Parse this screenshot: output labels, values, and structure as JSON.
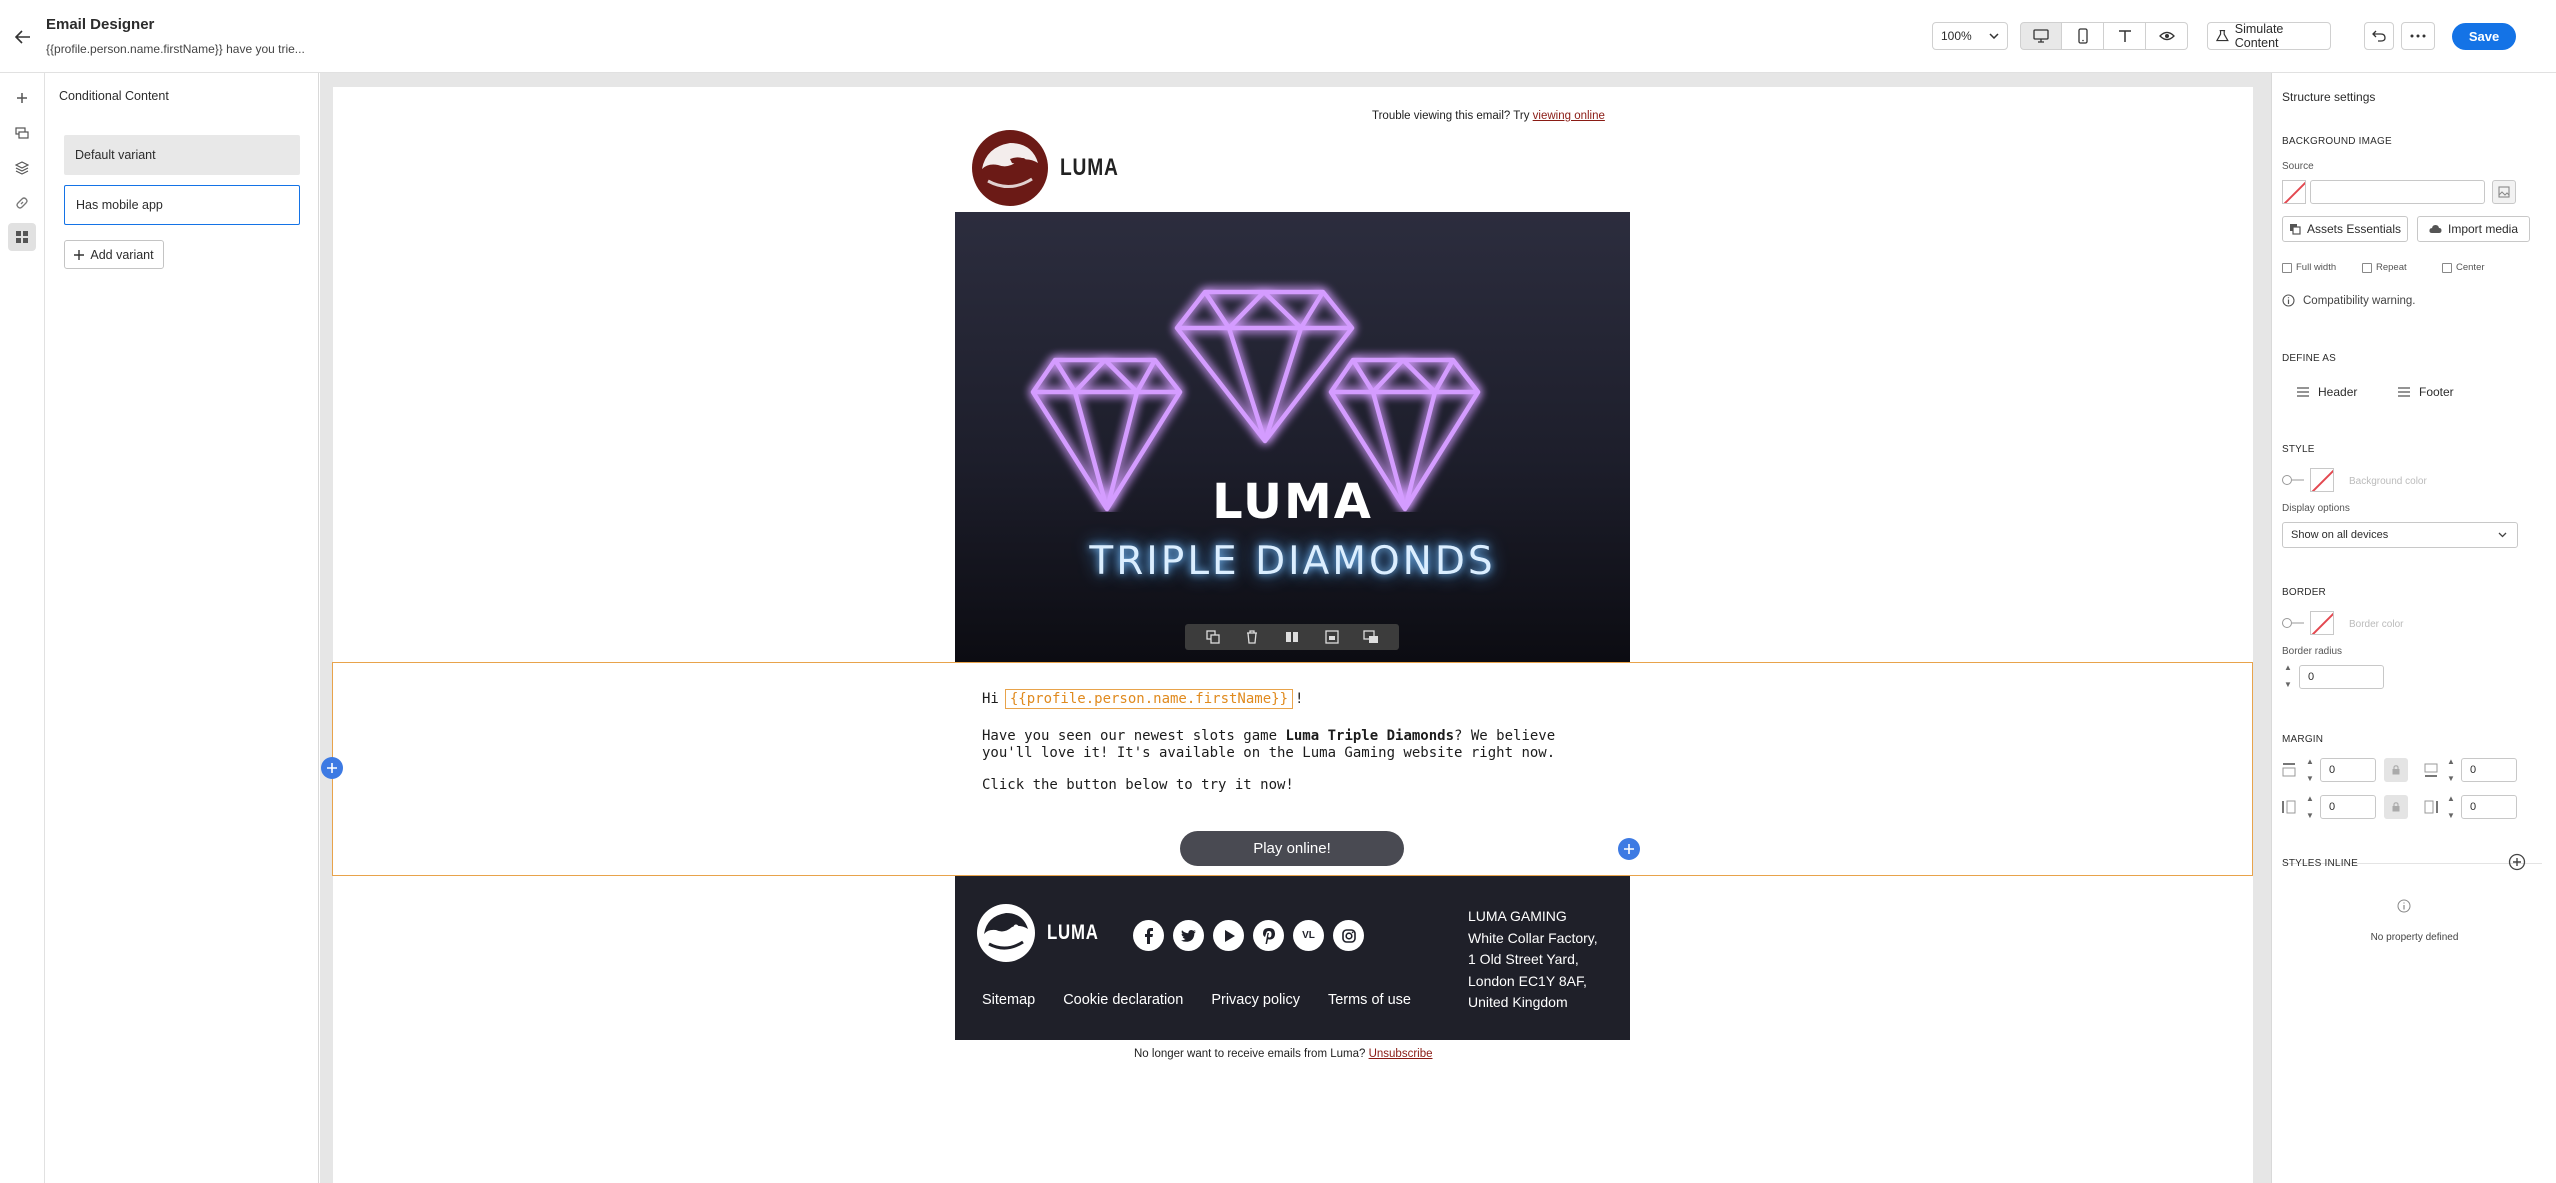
{
  "app": {
    "title": "Email Designer",
    "subject": "{{profile.person.name.firstName}} have you trie..."
  },
  "toolbar": {
    "zoom": "100%",
    "simulate_label": "Simulate Content",
    "save_label": "Save"
  },
  "left_panel": {
    "title": "Conditional Content",
    "variants": [
      {
        "label": "Default variant"
      },
      {
        "label": "Has mobile app"
      }
    ],
    "add_variant_label": "Add variant"
  },
  "email": {
    "preheader": "Trouble viewing this email? Try ",
    "preheader_link": "viewing online",
    "brand": "LUMA",
    "hero_title": "LUMA",
    "hero_subtitle": "TRIPLE DIAMONDS",
    "greeting_hi": "Hi",
    "greeting_token": "{{profile.person.name.firstName}}",
    "greeting_end": "!",
    "p1_a": "Have you seen our newest slots game ",
    "p1_bold": "Luma Triple Diamonds",
    "p1_b": "? We believe you'll love it! It's available on the Luma Gaming website right now.",
    "p2": "Click the button below to try it now!",
    "cta": "Play online!",
    "footer": {
      "brand": "LUMA",
      "social": [
        "facebook-icon",
        "twitter-icon",
        "youtube-icon",
        "pinterest-icon",
        "vl",
        "instagram-icon"
      ],
      "social_vl_text": "VL",
      "links": [
        "Sitemap",
        "Cookie declaration",
        "Privacy policy",
        "Terms of use"
      ],
      "address": [
        "LUMA GAMING",
        "White Collar Factory,",
        "1 Old Street Yard,",
        "London EC1Y 8AF,",
        "United Kingdom"
      ]
    },
    "unsubscribe_text": "No longer want to receive emails from Luma? ",
    "unsubscribe_link": "Unsubscribe"
  },
  "right_panel": {
    "title": "Structure settings",
    "bg_image_heading": "BACKGROUND IMAGE",
    "source_label": "Source",
    "assets_btn": "Assets Essentials",
    "import_btn": "Import media",
    "full_width": "Full width",
    "repeat": "Repeat",
    "center": "Center",
    "compat_warning": "Compatibility warning.",
    "define_as_heading": "DEFINE AS",
    "header_label": "Header",
    "footer_label": "Footer",
    "style_heading": "STYLE",
    "background_color": "Background color",
    "display_options_label": "Display options",
    "display_options_value": "Show on all devices",
    "border_heading": "BORDER",
    "border_color": "Border color",
    "border_radius_label": "Border radius",
    "border_radius_value": "0",
    "margin_heading": "MARGIN",
    "margin_top": "0",
    "margin_bottom": "0",
    "margin_left": "0",
    "margin_right": "0",
    "styles_inline_heading": "STYLES INLINE",
    "no_property": "No property defined"
  },
  "colors": {
    "accent": "#1473e6",
    "selection_outline": "#e8a34b",
    "link": "#8a1b14",
    "hero_neon": "#c77dff"
  }
}
